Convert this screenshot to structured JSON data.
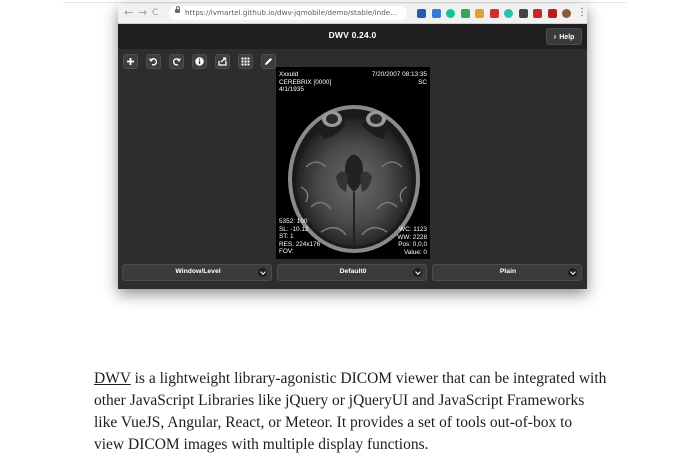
{
  "browser": {
    "back_label": "←",
    "forward_label": "→",
    "reload_label": "C",
    "url": "https://ivmartel.github.io/dwv-jqmobile/demo/stable/inde...",
    "bookmark_label": "☆",
    "menu_label": "⋮",
    "extensions": [
      {
        "name": "trello-icon",
        "color": "#1f5ea8"
      },
      {
        "name": "bing-icon",
        "color": "#3b7bd5"
      },
      {
        "name": "grammarly-icon",
        "color": "#15c39a"
      },
      {
        "name": "hangouts-icon",
        "color": "#34a853"
      },
      {
        "name": "snip-icon",
        "color": "#e0a32e"
      },
      {
        "name": "record-icon",
        "color": "#d32f2f"
      },
      {
        "name": "circle-ext-icon",
        "color": "#27c3a4"
      },
      {
        "name": "dark-ext-icon",
        "color": "#444444"
      },
      {
        "name": "red-ext-icon",
        "color": "#c62828"
      },
      {
        "name": "red-ext-2-icon",
        "color": "#b71c1c"
      },
      {
        "name": "avatar-icon",
        "color": "#8d5a3b"
      }
    ]
  },
  "app": {
    "title": "DWV 0.24.0",
    "help_label": "Help",
    "tools": [
      {
        "name": "add-file-button",
        "icon": "plus-icon"
      },
      {
        "name": "undo-button",
        "icon": "undo-icon"
      },
      {
        "name": "redo-button",
        "icon": "redo-icon"
      },
      {
        "name": "info-button",
        "icon": "info-icon"
      },
      {
        "name": "export-button",
        "icon": "export-icon"
      },
      {
        "name": "grid-button",
        "icon": "grid-icon"
      },
      {
        "name": "draw-button",
        "icon": "pencil-icon"
      }
    ]
  },
  "overlay": {
    "top_left": [
      "Xxxuld",
      "CEREBRIX [0000]",
      "4/1/1935"
    ],
    "top_right": [
      "7/20/2007 08:13:35",
      "SC"
    ],
    "bottom_left": [
      "5352: 100",
      "SL: -10.12",
      "ST: 1",
      "RES. 224x176",
      "FOV:"
    ],
    "bottom_right": [
      "WC: 1123",
      "WW: 2228",
      "Pos: 0,0,0",
      "Value: 0"
    ]
  },
  "dropdowns": [
    {
      "label": "Window/Level"
    },
    {
      "label": "Default0"
    },
    {
      "label": "Plain"
    }
  ],
  "article": {
    "link_text": "DWV",
    "line1_rest": " is a lightweight library-agonistic DICOM viewer that can be integrated with",
    "line2": "other JavaScript Libraries like jQuery or jQueryUI and JavaScript Frameworks",
    "line3": "like VueJS, Angular, React, or Meteor.  It provides a set of tools out-of-box to",
    "line4": "view DICOM images with multiple display functions."
  }
}
